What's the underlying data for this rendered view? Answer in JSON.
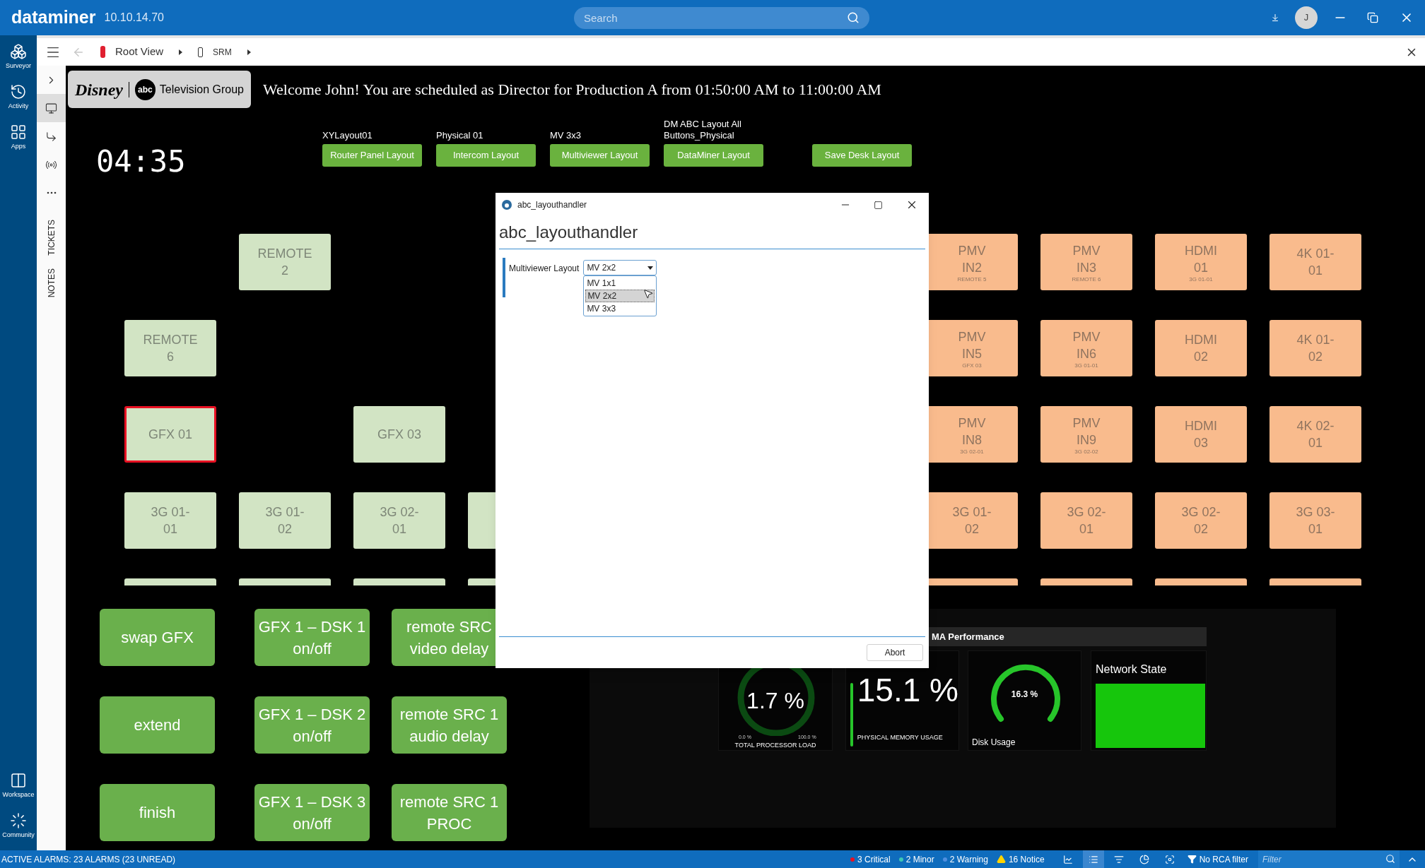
{
  "app_bar": {
    "brand": "dataminer",
    "version": "10.10.14.70",
    "search": {
      "placeholder": "Search"
    },
    "user_initial": "J"
  },
  "nav_rail": {
    "top": [
      {
        "label": "Surveyor",
        "kind": "surveyor"
      },
      {
        "label": "Activity",
        "kind": "activity"
      },
      {
        "label": "Apps",
        "kind": "apps"
      }
    ],
    "bottom": [
      {
        "label": "Workspace",
        "kind": "workspace"
      },
      {
        "label": "Community",
        "kind": "community"
      }
    ]
  },
  "breadcrumb": [
    {
      "label": "Root View",
      "kind": "view"
    },
    {
      "label": "SRM",
      "kind": "card"
    }
  ],
  "side_panel": {
    "tools": [
      {
        "kind": "expand",
        "selected": false
      },
      {
        "kind": "monitor",
        "selected": true
      },
      {
        "kind": "route",
        "selected": false
      },
      {
        "kind": "signal",
        "selected": false
      },
      {
        "kind": "more",
        "selected": false
      }
    ],
    "tabs": [
      "TICKETS",
      "NOTES"
    ]
  },
  "dashboard": {
    "logo": {
      "brand": "Disney",
      "network": "abc",
      "caption": "Television Group"
    },
    "welcome": "Welcome John! You are scheduled as Director for Production A from 01:50:00 AM to 11:00:00 AM",
    "clock": "04:35",
    "layouts": [
      {
        "kind": "layout",
        "caption": "XYLayout01",
        "button": "Router Panel Layout"
      },
      {
        "kind": "layout",
        "caption": "Physical 01",
        "button": "Intercom Layout"
      },
      {
        "kind": "layout",
        "caption": "MV 3x3",
        "button": "Multiviewer Layout"
      },
      {
        "kind": "layout",
        "caption": "DM ABC Layout All Buttons_Physical",
        "button": "DataMiner Layout"
      },
      {
        "kind": "save",
        "button": "Save Desk Layout"
      }
    ],
    "tile_rows": [
      [
        {
          "kind": "empty"
        },
        {
          "kind": "tile",
          "color": "#d2e4c4",
          "label": "REMOTE\n2",
          "selected": false
        },
        {
          "kind": "empty"
        },
        {
          "kind": "empty"
        },
        {
          "kind": "empty"
        },
        {
          "kind": "empty"
        },
        {
          "kind": "empty"
        },
        {
          "kind": "tile",
          "color": "#f9bb8d",
          "label": "PMV\nIN2",
          "sublabel": "REMOTE 5",
          "selected": false
        },
        {
          "kind": "tile",
          "color": "#f9bb8d",
          "label": "PMV\nIN3",
          "sublabel": "REMOTE 6",
          "selected": false
        },
        {
          "kind": "tile",
          "color": "#f9bb8d",
          "label": "HDMI\n01",
          "sublabel": "3G 01-01",
          "selected": false
        },
        {
          "kind": "tile",
          "color": "#f9bb8d",
          "label": "4K 01-\n01",
          "selected": false
        }
      ],
      [
        {
          "kind": "tile",
          "color": "#d2e4c4",
          "label": "REMOTE\n6",
          "selected": false
        },
        {
          "kind": "empty"
        },
        {
          "kind": "empty"
        },
        {
          "kind": "empty"
        },
        {
          "kind": "empty"
        },
        {
          "kind": "empty"
        },
        {
          "kind": "empty"
        },
        {
          "kind": "tile",
          "color": "#f9bb8d",
          "label": "PMV\nIN5",
          "sublabel": "GFX 03",
          "selected": false
        },
        {
          "kind": "tile",
          "color": "#f9bb8d",
          "label": "PMV\nIN6",
          "sublabel": "3G 01-01",
          "selected": false
        },
        {
          "kind": "tile",
          "color": "#f9bb8d",
          "label": "HDMI\n02",
          "selected": false
        },
        {
          "kind": "tile",
          "color": "#f9bb8d",
          "label": "4K 01-\n02",
          "selected": false
        }
      ],
      [
        {
          "kind": "tile",
          "color": "#d2e4c4",
          "label": "GFX 01",
          "selected": true
        },
        {
          "kind": "empty"
        },
        {
          "kind": "tile",
          "color": "#d2e4c4",
          "label": "GFX 03",
          "selected": false
        },
        {
          "kind": "empty"
        },
        {
          "kind": "empty"
        },
        {
          "kind": "empty"
        },
        {
          "kind": "empty"
        },
        {
          "kind": "tile",
          "color": "#f9bb8d",
          "label": "PMV\nIN8",
          "sublabel": "3G 02-01",
          "selected": false
        },
        {
          "kind": "tile",
          "color": "#f9bb8d",
          "label": "PMV\nIN9",
          "sublabel": "3G 02-02",
          "selected": false
        },
        {
          "kind": "tile",
          "color": "#f9bb8d",
          "label": "HDMI\n03",
          "selected": false
        },
        {
          "kind": "tile",
          "color": "#f9bb8d",
          "label": "4K 02-\n01",
          "selected": false
        }
      ],
      [
        {
          "kind": "tile",
          "color": "#d2e4c4",
          "label": "3G 01-\n01",
          "selected": false
        },
        {
          "kind": "tile",
          "color": "#d2e4c4",
          "label": "3G 01-\n02",
          "selected": false
        },
        {
          "kind": "tile",
          "color": "#d2e4c4",
          "label": "3G 02-\n01",
          "selected": false
        },
        {
          "kind": "tile",
          "color": "#d2e4c4",
          "selected": false
        },
        {
          "kind": "empty"
        },
        {
          "kind": "empty"
        },
        {
          "kind": "empty"
        },
        {
          "kind": "tile",
          "color": "#f9bb8d",
          "label": "3G 01-\n02",
          "selected": false
        },
        {
          "kind": "tile",
          "color": "#f9bb8d",
          "label": "3G 02-\n01",
          "selected": false
        },
        {
          "kind": "tile",
          "color": "#f9bb8d",
          "label": "3G 02-\n02",
          "selected": false
        },
        {
          "kind": "tile",
          "color": "#f9bb8d",
          "label": "3G 03-\n01",
          "selected": false
        }
      ],
      [
        {
          "kind": "tile",
          "color": "#d2e4c4",
          "selected": false
        },
        {
          "kind": "tile",
          "color": "#d2e4c4",
          "selected": false
        },
        {
          "kind": "tile",
          "color": "#d2e4c4",
          "selected": false
        },
        {
          "kind": "tile",
          "color": "#d2e4c4",
          "selected": false
        },
        {
          "kind": "empty"
        },
        {
          "kind": "empty"
        },
        {
          "kind": "empty"
        },
        {
          "kind": "tile",
          "color": "#f9bb8d",
          "selected": false
        },
        {
          "kind": "tile",
          "color": "#f9bb8d",
          "selected": false
        },
        {
          "kind": "tile",
          "color": "#f9bb8d",
          "selected": false
        },
        {
          "kind": "tile",
          "color": "#f9bb8d",
          "selected": false
        }
      ]
    ],
    "actions": [
      [
        "swap GFX",
        "extend",
        "finish"
      ],
      [
        "GFX 1 – DSK 1\non/off",
        "GFX 1 – DSK 2\non/off",
        "GFX 1 – DSK 3\non/off"
      ],
      [
        "remote SRC\nvideo delay",
        "remote SRC 1\naudio delay",
        "remote SRC 1\nPROC"
      ]
    ],
    "performance": {
      "title": "MA Performance",
      "processor": {
        "reading": "1.7 %",
        "min": "0.0 %",
        "max": "100.0 %",
        "label": "TOTAL PROCESSOR LOAD"
      },
      "memory": {
        "reading": "15.1 %",
        "label": "PHYSICAL MEMORY USAGE"
      },
      "disk": {
        "reading": "16.3 %",
        "label": "Disk Usage"
      },
      "network": {
        "label": "Network State",
        "healthy": true
      }
    }
  },
  "dialog": {
    "title": "abc_layouthandler",
    "heading": "abc_layouthandler",
    "field_label": "Multiviewer Layout",
    "value": "MV 2x2",
    "options": [
      {
        "label": "MV 1x1",
        "selected": false
      },
      {
        "label": "MV 2x2",
        "selected": true
      },
      {
        "label": "MV 3x3",
        "selected": false
      }
    ],
    "button": "Abort"
  },
  "status_bar": {
    "alarms": "ACTIVE ALARMS: 23 ALARMS (23 UNREAD)",
    "counts": [
      {
        "kind": "dot",
        "label": "3 Critical",
        "color": "#e81123"
      },
      {
        "kind": "dot",
        "label": "2 Minor",
        "color": "#3ec7b3"
      },
      {
        "kind": "dot",
        "label": "2 Warning",
        "color": "#4f8fe0"
      },
      {
        "kind": "warning",
        "label": "16 Notice"
      }
    ],
    "tools": [
      {
        "kind": "chart",
        "selected": false
      },
      {
        "kind": "list",
        "selected": true
      },
      {
        "kind": "sort",
        "selected": false
      },
      {
        "kind": "pie",
        "selected": false
      },
      {
        "kind": "focus",
        "selected": false
      }
    ],
    "rca_filter": "No RCA filter",
    "filter": {
      "placeholder": "Filter"
    }
  }
}
